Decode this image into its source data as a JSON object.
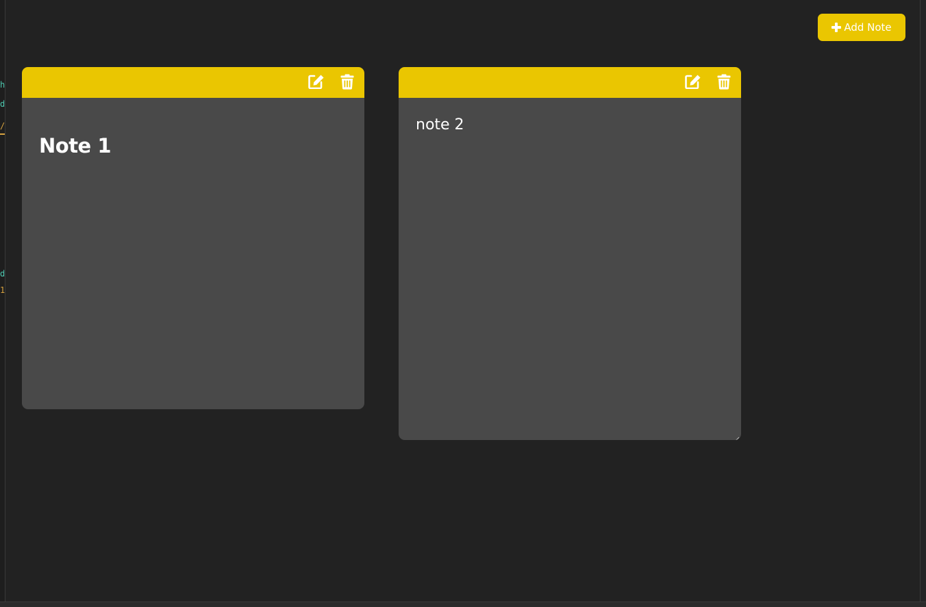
{
  "toolbar": {
    "add_label": "Add Note",
    "add_icon": "plus-icon"
  },
  "notes": [
    {
      "title": "Note 1",
      "mode": "preview",
      "tools": [
        "edit-icon",
        "trash-icon"
      ]
    },
    {
      "text": "note 2",
      "mode": "editing",
      "tools": [
        "edit-icon",
        "trash-icon"
      ]
    }
  ],
  "colors": {
    "background": "#222222",
    "note_body": "#494949",
    "accent": "#eac601",
    "text": "#ffffff"
  }
}
